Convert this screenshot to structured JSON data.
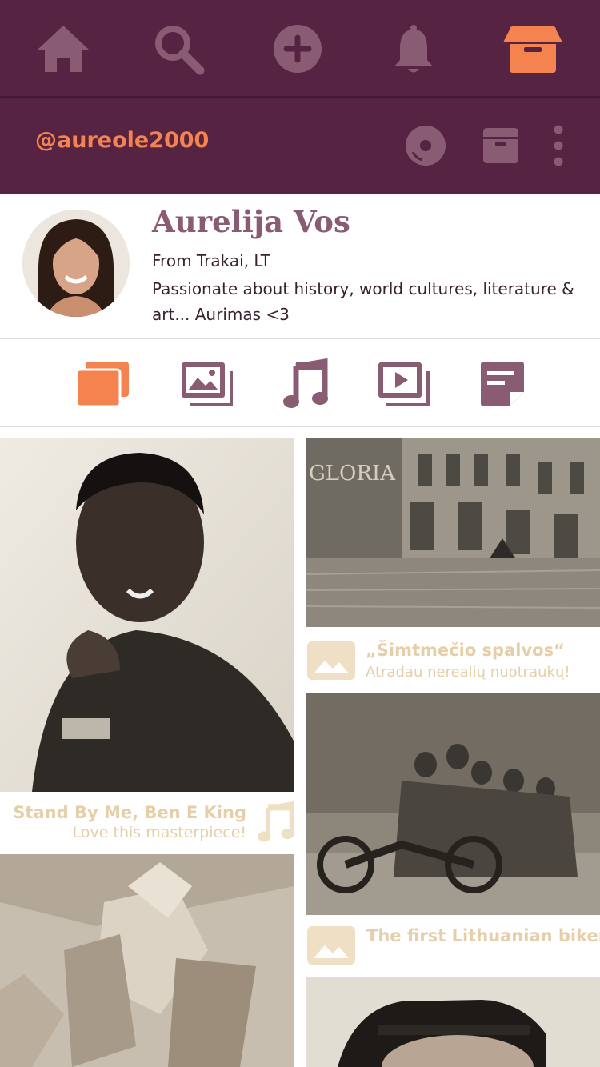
{
  "nav": {
    "items": [
      {
        "name": "home",
        "icon": "home-icon"
      },
      {
        "name": "search",
        "icon": "search-icon"
      },
      {
        "name": "add",
        "icon": "plus-circle-icon"
      },
      {
        "name": "notifications",
        "icon": "bell-icon"
      },
      {
        "name": "collection",
        "icon": "archive-box-icon",
        "active": true
      }
    ],
    "color": "#562343",
    "accent": "#f5834f",
    "icon_color": "#8a5c73"
  },
  "profile_bar": {
    "handle": "@aureole2000",
    "actions": [
      "disc-icon",
      "archive-icon",
      "more-vertical-icon"
    ]
  },
  "profile": {
    "name": "Aurelija Vos",
    "location": "From Trakai, LT",
    "bio": "Passionate about history, world cultures, literature & art... Aurimas <3"
  },
  "tabs": [
    {
      "name": "all",
      "icon": "stack-icon",
      "active": true
    },
    {
      "name": "images",
      "icon": "images-icon"
    },
    {
      "name": "music",
      "icon": "music-note-icon"
    },
    {
      "name": "videos",
      "icon": "video-icon"
    },
    {
      "name": "notes",
      "icon": "note-icon"
    }
  ],
  "feed": {
    "left": [
      {
        "type": "music",
        "title": "Stand By Me, Ben E King",
        "subtitle": "Love this masterpiece!",
        "icon": "music-note-icon"
      },
      {
        "type": "image",
        "title": "",
        "subtitle": ""
      }
    ],
    "right": [
      {
        "type": "image",
        "sign": "GLORIA",
        "title": "„Šimtmečio spalvos“",
        "subtitle": "Atradau nerealių nuotraukų!",
        "icon": "image-icon"
      },
      {
        "type": "image",
        "title": "The first Lithuanian bikers",
        "subtitle": "",
        "icon": "image-icon"
      },
      {
        "type": "image",
        "title": "",
        "subtitle": ""
      }
    ]
  }
}
